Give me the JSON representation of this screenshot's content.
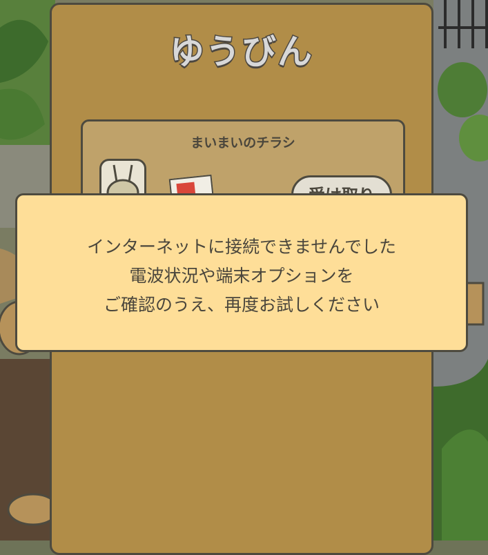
{
  "mailbox": {
    "title": "ゆうびん",
    "card_title": "まいまいのチラシ",
    "receive_label": "受け取り"
  },
  "error_dialog": {
    "line1": "インターネットに接続できませんでした",
    "line2": "電波状況や端末オプションを",
    "line3": "ご確認のうえ、再度お試しください"
  },
  "colors": {
    "panel": "#b18d48",
    "card": "#bfa26a",
    "dialog": "#fede98",
    "outline": "#4d4a3f"
  }
}
